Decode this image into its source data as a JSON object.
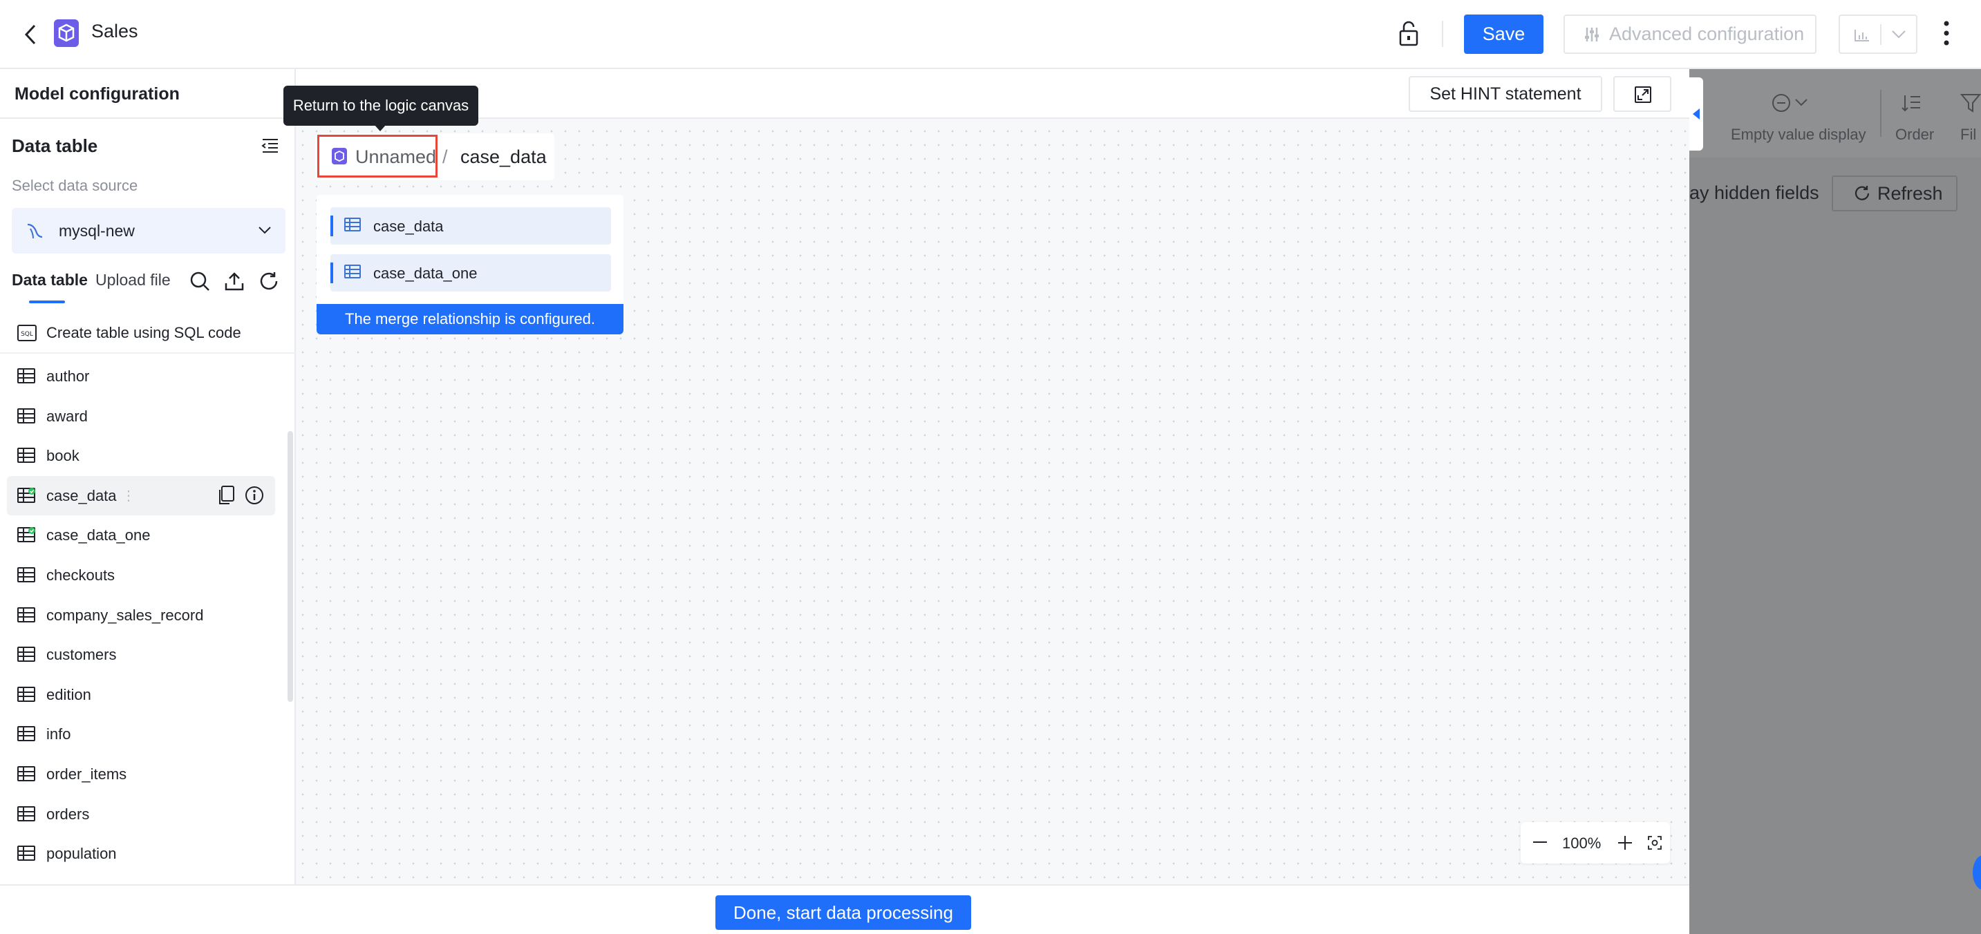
{
  "header": {
    "title": "Sales",
    "save_label": "Save",
    "advanced_label": "Advanced configuration"
  },
  "left": {
    "model_config_title": "Model configuration",
    "data_table_title": "Data table",
    "select_source_label": "Select data source",
    "data_source": "mysql-new",
    "tabs": [
      "Data table",
      "Upload file"
    ],
    "sql_create_label": "Create table using SQL code",
    "tables": [
      {
        "name": "author",
        "status": ""
      },
      {
        "name": "award",
        "status": ""
      },
      {
        "name": "book",
        "status": ""
      },
      {
        "name": "case_data",
        "status": "used",
        "active": true
      },
      {
        "name": "case_data_one",
        "status": "used"
      },
      {
        "name": "checkouts",
        "status": ""
      },
      {
        "name": "company_sales_record",
        "status": ""
      },
      {
        "name": "customers",
        "status": ""
      },
      {
        "name": "edition",
        "status": ""
      },
      {
        "name": "info",
        "status": ""
      },
      {
        "name": "order_items",
        "status": ""
      },
      {
        "name": "orders",
        "status": ""
      },
      {
        "name": "population",
        "status": ""
      }
    ]
  },
  "canvas": {
    "hint_button": "Set HINT statement",
    "tooltip": "Return to the logic canvas",
    "breadcrumb": {
      "root": "Unnamed",
      "separator": "/",
      "current": "case_data"
    },
    "node": {
      "tables": [
        "case_data",
        "case_data_one"
      ],
      "footer": "The merge relationship is configured."
    },
    "zoom": "100%"
  },
  "footer": {
    "done_label": "Done, start data processing"
  },
  "right": {
    "empty_value_label": "Empty value display",
    "order_label": "Order",
    "filter_label": "Fil",
    "hidden_fields_label": "ay hidden fields",
    "refresh_label": "Refresh"
  },
  "colors": {
    "accent": "#1f6ffb",
    "highlight": "#e5483b",
    "brand_icon": "#6c5ce7",
    "used_dot": "#2dbf5a"
  }
}
